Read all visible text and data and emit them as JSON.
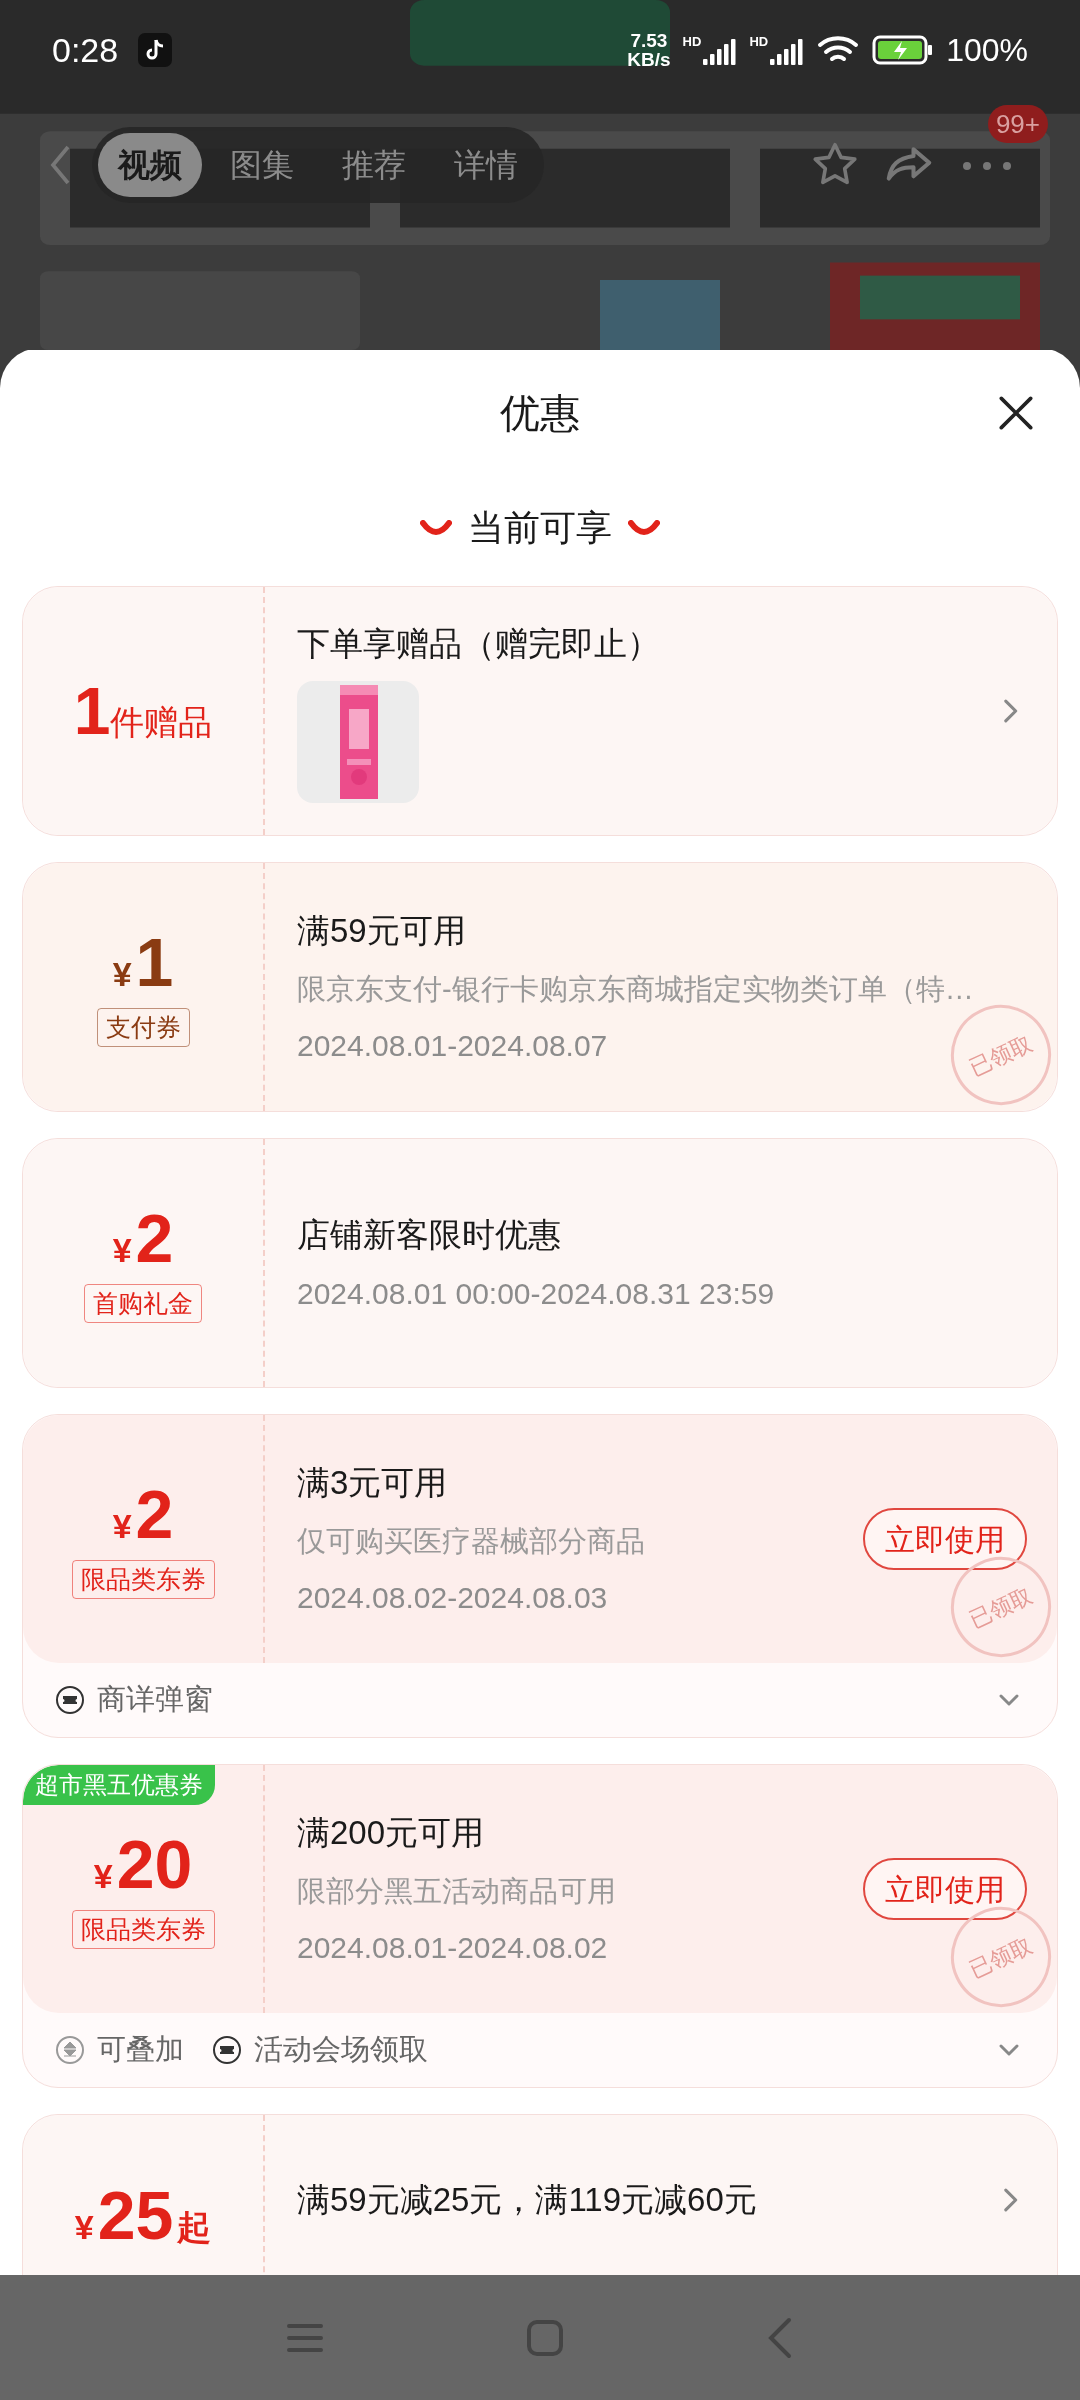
{
  "status_bar": {
    "time": "0:28",
    "net_speed": "7.53",
    "net_unit": "KB/s",
    "signal_labels": [
      "HD",
      "HD"
    ],
    "battery": "100%"
  },
  "product_header": {
    "tabs": [
      {
        "label": "视频",
        "selected": true
      },
      {
        "label": "图集",
        "selected": false
      },
      {
        "label": "推荐",
        "selected": false
      },
      {
        "label": "详情",
        "selected": false
      }
    ],
    "badge": "99+"
  },
  "sheet": {
    "title": "优惠",
    "section_title": "当前可享"
  },
  "offers": [
    {
      "kind": "gift",
      "count": "1",
      "unit": "件赠品",
      "title": "下单享赠品（赠完即止）"
    },
    {
      "kind": "coupon",
      "currency": "¥",
      "amount": "1",
      "tag": "支付券",
      "color": "#8a3b12",
      "title": "满59元可用",
      "description": "限京东支付-银行卡购京东商城指定实物类订单（特…",
      "dates": "2024.08.01-2024.08.07",
      "stamp": "已领取"
    },
    {
      "kind": "coupon",
      "currency": "¥",
      "amount": "2",
      "tag": "首购礼金",
      "color": "#e2231a",
      "title": "店铺新客限时优惠",
      "dates": "2024.08.01 00:00-2024.08.31 23:59"
    },
    {
      "kind": "coupon",
      "currency": "¥",
      "amount": "2",
      "tag": "限品类东券",
      "color": "#e2231a",
      "title": "满3元可用",
      "description": "仅可购买医疗器械部分商品",
      "dates": "2024.08.02-2024.08.03",
      "button": "立即使用",
      "stamp": "已领取",
      "footer": [
        {
          "kind": "ticket",
          "label": "商详弹窗"
        }
      ]
    },
    {
      "kind": "coupon",
      "ribbon": "超市黑五优惠券",
      "currency": "¥",
      "amount": "20",
      "tag": "限品类东券",
      "color": "#e2231a",
      "title": "满200元可用",
      "description": "限部分黑五活动商品可用",
      "dates": "2024.08.01-2024.08.02",
      "button": "立即使用",
      "stamp": "已领取",
      "footer": [
        {
          "kind": "stack",
          "label": "可叠加"
        },
        {
          "kind": "ticket",
          "label": "活动会场领取"
        }
      ]
    },
    {
      "kind": "promo",
      "currency": "¥",
      "amount": "25",
      "suffix": "起",
      "color": "#e2231a",
      "title": "满59元减25元，满119元减60元"
    }
  ]
}
